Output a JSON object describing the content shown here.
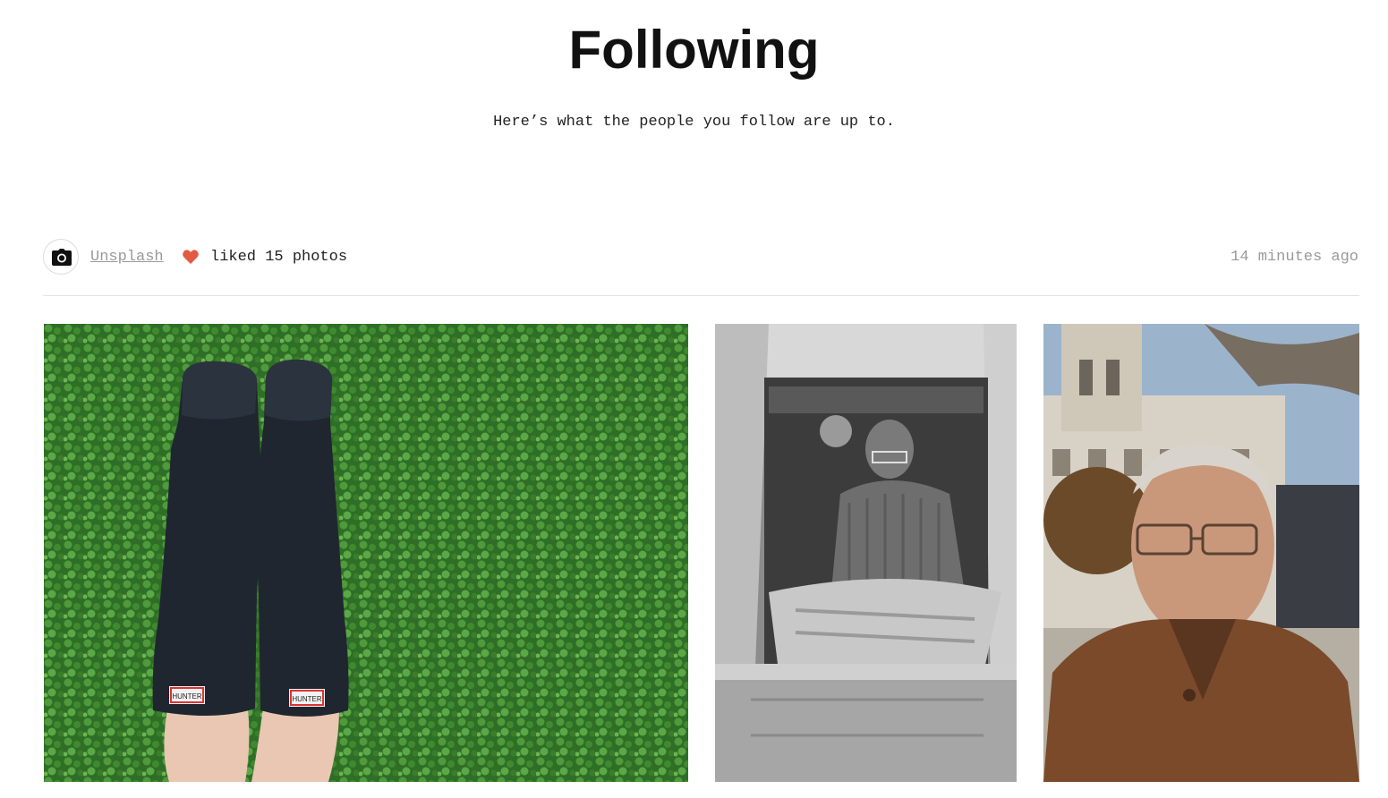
{
  "header": {
    "title": "Following",
    "subtitle": "Here’s what the people you follow are up to."
  },
  "activity": {
    "user_name": "Unsplash",
    "action": "liked 15 photos",
    "timestamp": "14 minutes ago",
    "avatar_icon": "camera-icon",
    "action_icon": "heart-icon",
    "heart_color": "#e25c45"
  },
  "photos": [
    {
      "subject": "rain boots on clover"
    },
    {
      "subject": "man sewing in workshop"
    },
    {
      "subject": "elderly man in brown jacket"
    }
  ],
  "photo_boot_labels": [
    "HUNTER",
    "HUNTER"
  ]
}
